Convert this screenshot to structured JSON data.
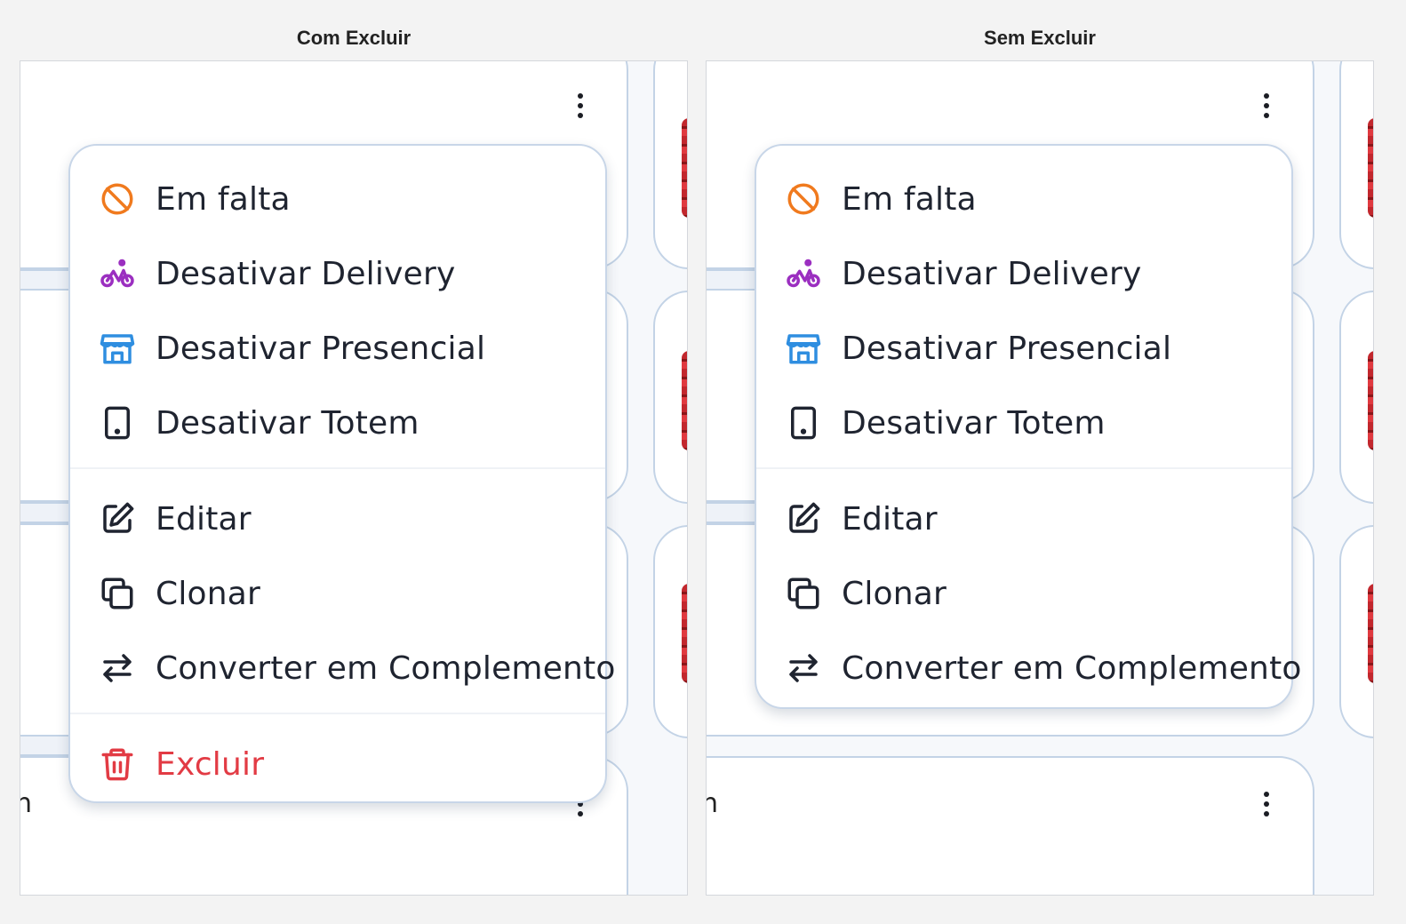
{
  "panels": [
    {
      "title": "Com Excluir",
      "menu": {
        "group1": [
          {
            "label": "Em falta",
            "icon": "out-of-stock-icon"
          },
          {
            "label": "Desativar Delivery",
            "icon": "bicycle-icon"
          },
          {
            "label": "Desativar Presencial",
            "icon": "store-icon"
          },
          {
            "label": "Desativar Totem",
            "icon": "tablet-icon"
          }
        ],
        "group2": [
          {
            "label": "Editar",
            "icon": "edit-icon"
          },
          {
            "label": "Clonar",
            "icon": "copy-icon"
          },
          {
            "label": "Converter em Complemento",
            "icon": "swap-icon"
          }
        ],
        "danger": {
          "label": "Excluir",
          "icon": "trash-icon"
        }
      }
    },
    {
      "title": "Sem Excluir",
      "menu": {
        "group1": [
          {
            "label": "Em falta",
            "icon": "out-of-stock-icon"
          },
          {
            "label": "Desativar Delivery",
            "icon": "bicycle-icon"
          },
          {
            "label": "Desativar Presencial",
            "icon": "store-icon"
          },
          {
            "label": "Desativar Totem",
            "icon": "tablet-icon"
          }
        ],
        "group2": [
          {
            "label": "Editar",
            "icon": "edit-icon"
          },
          {
            "label": "Clonar",
            "icon": "copy-icon"
          },
          {
            "label": "Converter em Complemento",
            "icon": "swap-icon"
          }
        ]
      }
    }
  ],
  "background_cut_text": "n",
  "colors": {
    "out_of_stock": "#f07a1e",
    "delivery": "#9b2fc0",
    "store": "#2f8ee0",
    "text": "#1f2430",
    "danger": "#e23b44",
    "card_border": "#c3d3e6"
  }
}
